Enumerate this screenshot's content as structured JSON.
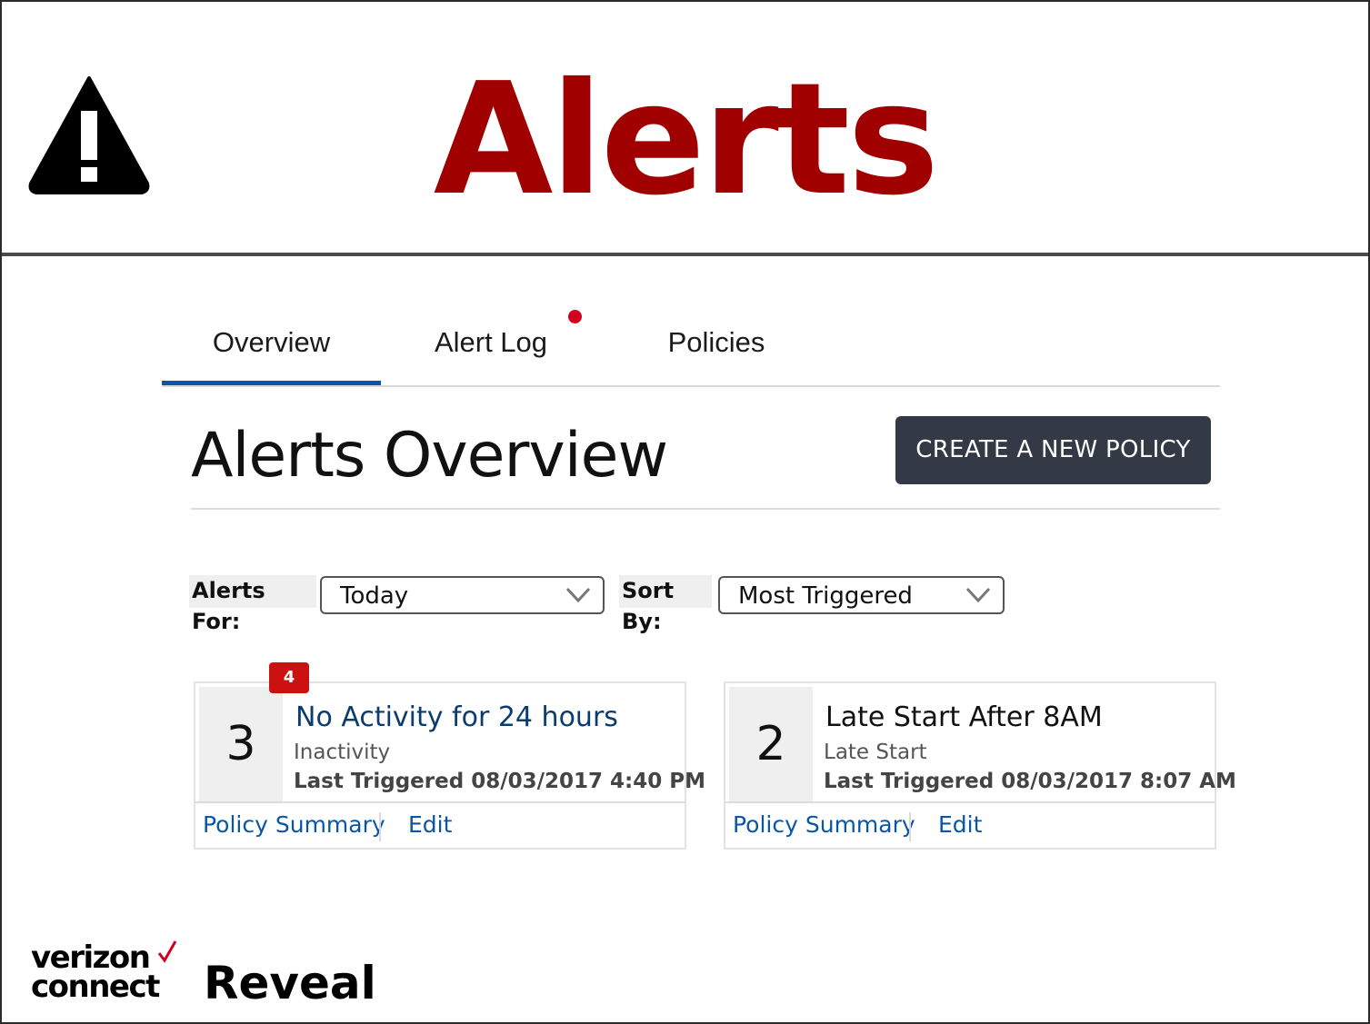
{
  "header": {
    "title": "Alerts",
    "icon": "warning-icon"
  },
  "tabs": [
    {
      "label": "Overview",
      "active": true
    },
    {
      "label": "Alert Log",
      "has_notification": true
    },
    {
      "label": "Policies"
    }
  ],
  "page": {
    "title": "Alerts Overview",
    "create_label": "CREATE A NEW POLICY"
  },
  "filters": {
    "alerts_for_label": "Alerts For:",
    "alerts_for_value": "Today",
    "sort_by_label": "Sort By:",
    "sort_by_value": "Most Triggered"
  },
  "cards": [
    {
      "count": "3",
      "badge": "4",
      "title": "No Activity for 24 hours",
      "type": "Inactivity",
      "last_triggered": "Last Triggered 08/03/2017  4:40 PM",
      "link_summary": "Policy Summary",
      "link_edit": "Edit"
    },
    {
      "count": "2",
      "title": "Late Start After 8AM",
      "type": "Late Start",
      "last_triggered": "Last Triggered 08/03/2017  8:07 AM",
      "link_summary": "Policy Summary",
      "link_edit": "Edit"
    }
  ],
  "brand": {
    "line1": "verizon",
    "line2": "connect",
    "product": "Reveal"
  },
  "colors": {
    "title_red": "#a00000",
    "active_tab": "#0a56a6",
    "button_bg": "#343a45",
    "badge_red": "#cc1111",
    "link_blue": "#0a56a6",
    "verizon_check": "#d1001f"
  }
}
